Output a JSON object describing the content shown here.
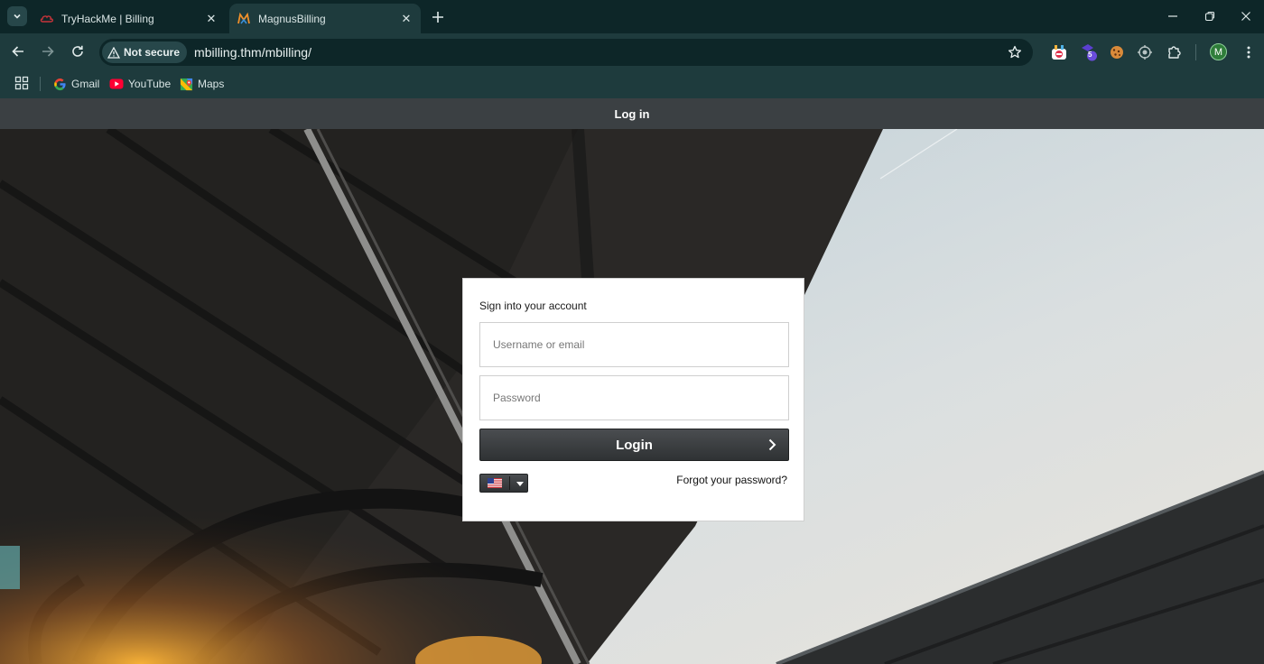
{
  "browser": {
    "tabs": [
      {
        "title": "TryHackMe | Billing",
        "active": false
      },
      {
        "title": "MagnusBilling",
        "active": true
      }
    ],
    "omnibox": {
      "security_label": "Not secure",
      "url": "mbilling.thm/mbilling/"
    },
    "profile_initial": "M",
    "extension_badge": "5",
    "bookmarks": [
      {
        "label": "Gmail",
        "icon": "google-icon"
      },
      {
        "label": "YouTube",
        "icon": "youtube-icon"
      },
      {
        "label": "Maps",
        "icon": "maps-icon"
      }
    ]
  },
  "page": {
    "header_title": "Log in",
    "login": {
      "title": "Sign into your account",
      "username_placeholder": "Username or email",
      "password_placeholder": "Password",
      "submit_label": "Login",
      "language": "en-US",
      "forgot_label": "Forgot your password?"
    }
  },
  "colors": {
    "tabstrip": "#0d2628",
    "toolbar": "#1e3b3d",
    "page_header": "#3b4043",
    "button": "#3a3d40"
  }
}
